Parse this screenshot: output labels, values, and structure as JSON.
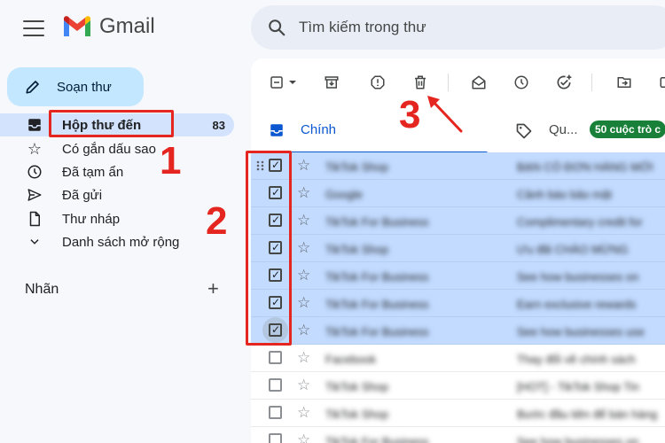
{
  "app": {
    "name": "Gmail"
  },
  "search": {
    "placeholder": "Tìm kiếm trong thư"
  },
  "sidebar": {
    "compose_label": "Soạn thư",
    "items": [
      {
        "label": "Hộp thư đến",
        "count": "83",
        "icon": "inbox-icon"
      },
      {
        "label": "Có gắn dấu sao",
        "icon": "star-icon"
      },
      {
        "label": "Đã tạm ẩn",
        "icon": "clock-icon"
      },
      {
        "label": "Đã gửi",
        "icon": "send-icon"
      },
      {
        "label": "Thư nháp",
        "icon": "draft-icon"
      },
      {
        "label": "Danh sách mở rộng",
        "icon": "chevron-down-icon"
      }
    ],
    "labels_heading": "Nhãn",
    "labels_add": "+"
  },
  "toolbar": {
    "icons": [
      "select-all-checkbox-icon",
      "select-dropdown-icon",
      "archive-icon",
      "report-spam-icon",
      "delete-icon",
      "mark-read-icon",
      "snooze-icon",
      "add-task-icon",
      "move-to-icon",
      "label-icon"
    ]
  },
  "tabs": {
    "primary": "Chính",
    "promotions": "Qu...",
    "promotions_badge": "50 cuộc trò c"
  },
  "emails": [
    {
      "sender": "TikTok Shop",
      "subject": "BẠN CÓ ĐƠN HÀNG MỚI",
      "selected": true
    },
    {
      "sender": "Google",
      "subject": "Cảnh báo bảo mật",
      "selected": true
    },
    {
      "sender": "TikTok For Business",
      "subject": "Complimentary credit for",
      "selected": true
    },
    {
      "sender": "TikTok Shop",
      "subject": "Ưu đãi CHÀO MỪNG",
      "selected": true
    },
    {
      "sender": "TikTok For Business",
      "subject": "See how businesses on",
      "selected": true
    },
    {
      "sender": "TikTok For Business",
      "subject": "Earn exclusive rewards",
      "selected": true
    },
    {
      "sender": "TikTok For Business",
      "subject": "See how businesses use",
      "selected": true
    },
    {
      "sender": "Facebook",
      "subject": "Thay đổi về chính sách",
      "selected": false
    },
    {
      "sender": "TikTok Shop",
      "subject": "[HOT] - TikTok Shop Tin",
      "selected": false
    },
    {
      "sender": "TikTok Shop",
      "subject": "Bước đầu tiên để bán hàng",
      "selected": false
    },
    {
      "sender": "TikTok For Business",
      "subject": "See how businesses on",
      "selected": false
    }
  ],
  "annotations": {
    "one": "1",
    "two": "2",
    "three": "3"
  },
  "colors": {
    "annotation": "#e52620",
    "selection": "#c2dbff",
    "compose": "#c2e7ff",
    "accent": "#0b57d0"
  }
}
